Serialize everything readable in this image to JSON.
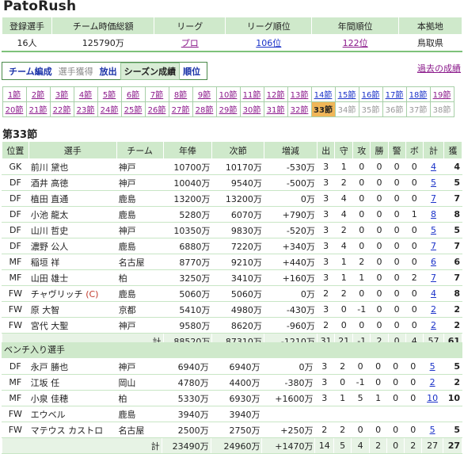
{
  "title": "PatoRush",
  "summary": {
    "headers": [
      "登録選手",
      "チーム時価総額",
      "リーグ",
      "リーグ順位",
      "年間順位",
      "本拠地"
    ],
    "values": [
      "16人",
      "125790万",
      "プロ",
      "106位",
      "122位",
      "鳥取県"
    ]
  },
  "modes": [
    "チーム編成",
    "選手獲得",
    "放出",
    "シーズン成績",
    "順位"
  ],
  "past_link": "過去の成績",
  "rounds": [
    "1節",
    "2節",
    "3節",
    "4節",
    "5節",
    "6節",
    "7節",
    "8節",
    "9節",
    "10節",
    "11節",
    "12節",
    "13節",
    "14節",
    "15節",
    "16節",
    "17節",
    "18節",
    "19節",
    "20節",
    "21節",
    "22節",
    "23節",
    "24節",
    "25節",
    "26節",
    "27節",
    "28節",
    "29節",
    "30節",
    "31節",
    "32節",
    "33節",
    "34節",
    "35節",
    "36節",
    "37節",
    "38節"
  ],
  "current_round": "第33節",
  "columns": [
    "位置",
    "選手",
    "チーム",
    "年俸",
    "次節",
    "増減",
    "出",
    "守",
    "攻",
    "勝",
    "警",
    "ボ",
    "計",
    "獲"
  ],
  "starters": [
    {
      "pos": "GK",
      "name": "前川 黛也",
      "cap": "",
      "team": "神戸",
      "sal": "10700万",
      "next": "10170万",
      "diff": "-530万",
      "a": "3",
      "b": "1",
      "c": "0",
      "d": "0",
      "e": "0",
      "f": "0",
      "total": "4",
      "g": "4"
    },
    {
      "pos": "DF",
      "name": "酒井 高徳",
      "cap": "",
      "team": "神戸",
      "sal": "10040万",
      "next": "9540万",
      "diff": "-500万",
      "a": "3",
      "b": "2",
      "c": "0",
      "d": "0",
      "e": "0",
      "f": "0",
      "total": "5",
      "g": "5"
    },
    {
      "pos": "DF",
      "name": "植田 直通",
      "cap": "",
      "team": "鹿島",
      "sal": "13200万",
      "next": "13200万",
      "diff": "0万",
      "a": "3",
      "b": "4",
      "c": "0",
      "d": "0",
      "e": "0",
      "f": "0",
      "total": "7",
      "g": "7"
    },
    {
      "pos": "DF",
      "name": "小池 龍太",
      "cap": "",
      "team": "鹿島",
      "sal": "5280万",
      "next": "6070万",
      "diff": "+790万",
      "a": "3",
      "b": "4",
      "c": "0",
      "d": "0",
      "e": "0",
      "f": "1",
      "total": "8",
      "g": "8"
    },
    {
      "pos": "DF",
      "name": "山川 哲史",
      "cap": "",
      "team": "神戸",
      "sal": "10350万",
      "next": "9830万",
      "diff": "-520万",
      "a": "3",
      "b": "2",
      "c": "0",
      "d": "0",
      "e": "0",
      "f": "0",
      "total": "5",
      "g": "5"
    },
    {
      "pos": "DF",
      "name": "濃野 公人",
      "cap": "",
      "team": "鹿島",
      "sal": "6880万",
      "next": "7220万",
      "diff": "+340万",
      "a": "3",
      "b": "4",
      "c": "0",
      "d": "0",
      "e": "0",
      "f": "0",
      "total": "7",
      "g": "7"
    },
    {
      "pos": "MF",
      "name": "稲垣 祥",
      "cap": "",
      "team": "名古屋",
      "sal": "8770万",
      "next": "9210万",
      "diff": "+440万",
      "a": "3",
      "b": "1",
      "c": "2",
      "d": "0",
      "e": "0",
      "f": "0",
      "total": "6",
      "g": "6"
    },
    {
      "pos": "MF",
      "name": "山田 雄士",
      "cap": "",
      "team": "柏",
      "sal": "3250万",
      "next": "3410万",
      "diff": "+160万",
      "a": "3",
      "b": "1",
      "c": "1",
      "d": "0",
      "e": "0",
      "f": "2",
      "total": "7",
      "g": "7"
    },
    {
      "pos": "FW",
      "name": "チャヴリッチ",
      "cap": "(C)",
      "team": "鹿島",
      "sal": "5060万",
      "next": "5060万",
      "diff": "0万",
      "a": "2",
      "b": "2",
      "c": "0",
      "d": "0",
      "e": "0",
      "f": "0",
      "total": "4",
      "g": "8"
    },
    {
      "pos": "FW",
      "name": "原 大智",
      "cap": "",
      "team": "京都",
      "sal": "5410万",
      "next": "4980万",
      "diff": "-430万",
      "a": "3",
      "b": "0",
      "c": "-1",
      "d": "0",
      "e": "0",
      "f": "0",
      "total": "2",
      "g": "2"
    },
    {
      "pos": "FW",
      "name": "宮代 大聖",
      "cap": "",
      "team": "神戸",
      "sal": "9580万",
      "next": "8620万",
      "diff": "-960万",
      "a": "2",
      "b": "0",
      "c": "0",
      "d": "0",
      "e": "0",
      "f": "0",
      "total": "2",
      "g": "2"
    }
  ],
  "starters_total": {
    "label": "計",
    "sal": "88520万",
    "next": "87310万",
    "diff": "-1210万",
    "a": "31",
    "b": "21",
    "c": "-1",
    "d": "2",
    "e": "0",
    "f": "4",
    "total": "57",
    "g": "61"
  },
  "bench_label": "ベンチ入り選手",
  "bench": [
    {
      "pos": "DF",
      "name": "永戸 勝也",
      "cap": "",
      "team": "神戸",
      "sal": "6940万",
      "next": "6940万",
      "diff": "0万",
      "a": "3",
      "b": "2",
      "c": "0",
      "d": "0",
      "e": "0",
      "f": "0",
      "total": "5",
      "g": "5"
    },
    {
      "pos": "MF",
      "name": "江坂 任",
      "cap": "",
      "team": "岡山",
      "sal": "4780万",
      "next": "4400万",
      "diff": "-380万",
      "a": "3",
      "b": "0",
      "c": "-1",
      "d": "0",
      "e": "0",
      "f": "0",
      "total": "2",
      "g": "2"
    },
    {
      "pos": "MF",
      "name": "小泉 佳穂",
      "cap": "",
      "team": "柏",
      "sal": "5330万",
      "next": "6930万",
      "diff": "+1600万",
      "a": "3",
      "b": "1",
      "c": "5",
      "d": "1",
      "e": "0",
      "f": "0",
      "total": "10",
      "g": "10"
    },
    {
      "pos": "FW",
      "name": "エウベル",
      "cap": "",
      "team": "鹿島",
      "sal": "3940万",
      "next": "3940万",
      "diff": "",
      "a": "",
      "b": "",
      "c": "",
      "d": "",
      "e": "",
      "f": "",
      "total": "",
      "g": ""
    },
    {
      "pos": "FW",
      "name": "マテウス カストロ",
      "cap": "",
      "team": "名古屋",
      "sal": "2500万",
      "next": "2750万",
      "diff": "+250万",
      "a": "2",
      "b": "2",
      "c": "0",
      "d": "0",
      "e": "0",
      "f": "0",
      "total": "5",
      "g": "5"
    }
  ],
  "bench_total": {
    "label": "計",
    "sal": "23490万",
    "next": "24960万",
    "diff": "+1470万",
    "a": "14",
    "b": "5",
    "c": "4",
    "d": "2",
    "e": "0",
    "f": "2",
    "total": "27",
    "g": "27"
  }
}
